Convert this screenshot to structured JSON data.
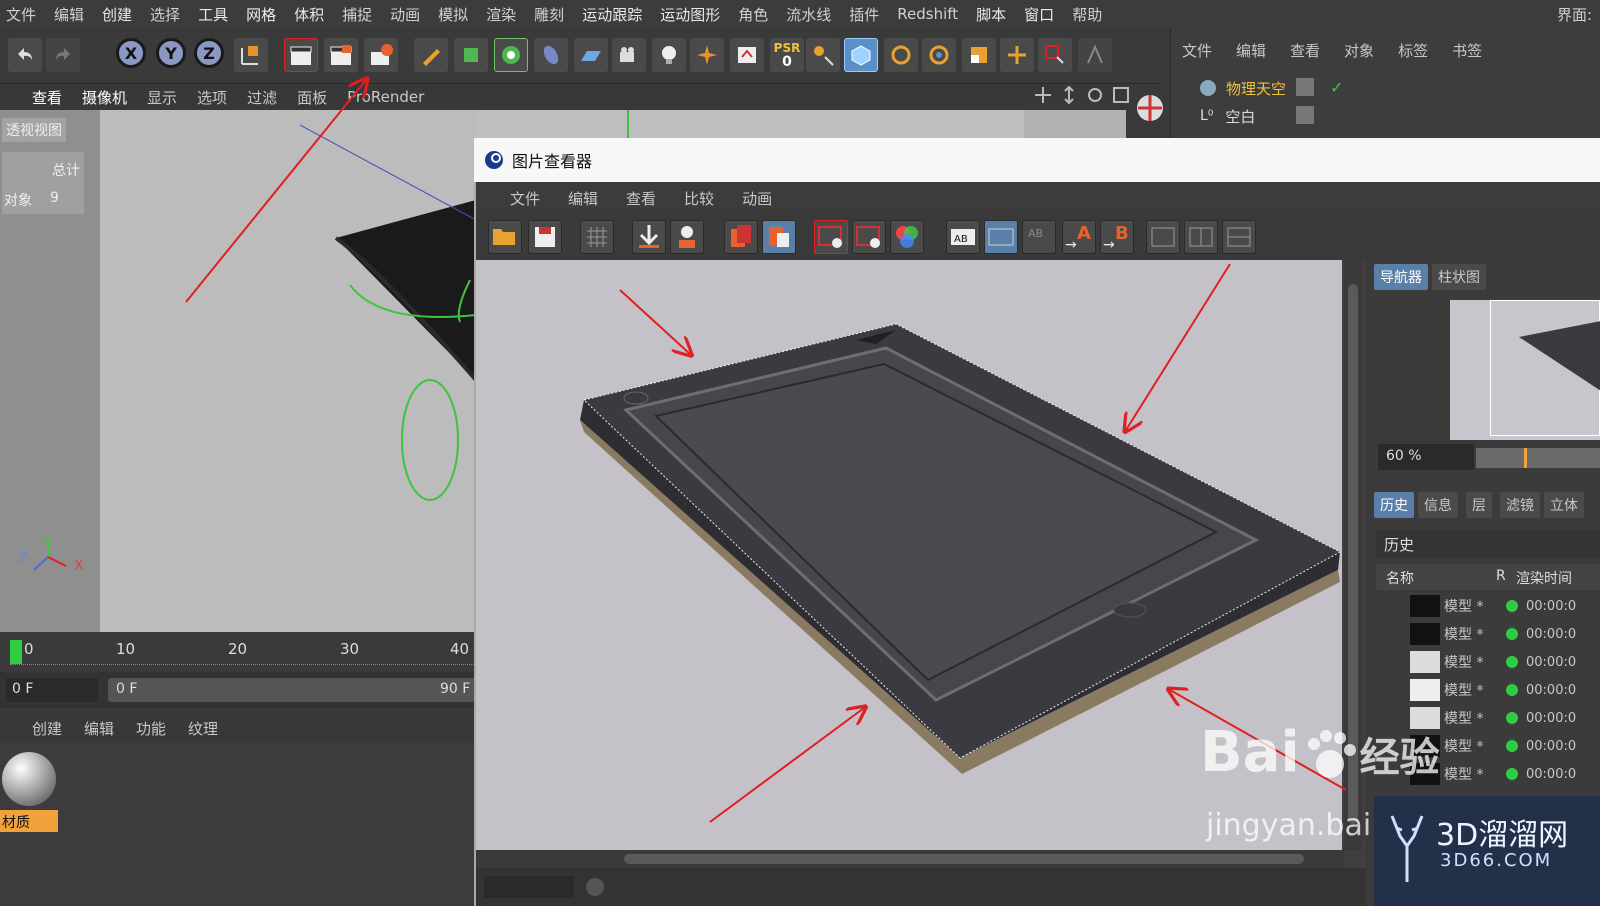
{
  "menubar": {
    "items": [
      {
        "label": "文件",
        "hl": false
      },
      {
        "label": "编辑",
        "hl": false
      },
      {
        "label": "创建",
        "hl": false
      },
      {
        "label": "选择",
        "hl": false
      },
      {
        "label": "工具",
        "hl": false
      },
      {
        "label": "网格",
        "hl": false
      },
      {
        "label": "体积",
        "hl": false
      },
      {
        "label": "捕捉",
        "hl": false
      },
      {
        "label": "动画",
        "hl": false
      },
      {
        "label": "模拟",
        "hl": false
      },
      {
        "label": "渲染",
        "hl": false
      },
      {
        "label": "雕刻",
        "hl": false
      },
      {
        "label": "运动跟踪",
        "hl": false
      },
      {
        "label": "运动图形",
        "hl": false
      },
      {
        "label": "角色",
        "hl": false
      },
      {
        "label": "流水线",
        "hl": false
      },
      {
        "label": "插件",
        "hl": false
      },
      {
        "label": "Redshift",
        "hl": false
      },
      {
        "label": "脚本",
        "hl": false
      },
      {
        "label": "窗口",
        "hl": false
      },
      {
        "label": "帮助",
        "hl": false
      }
    ],
    "layout_label": "界面:"
  },
  "toolbar": {
    "axis_x": "X",
    "axis_y": "Y",
    "axis_z": "Z",
    "psr_label": "PSR",
    "psr_value": "0"
  },
  "viewport": {
    "menu": [
      "查看",
      "摄像机",
      "显示",
      "选项",
      "过滤",
      "面板",
      "ProRender"
    ],
    "view_name": "透视视图",
    "stats_total": "总计",
    "stats_objects_label": "对象",
    "stats_objects_value": "9",
    "axis_labels": {
      "z": "Z",
      "y": "Y",
      "x": "X"
    }
  },
  "object_manager": {
    "tabs": [
      "文件",
      "编辑",
      "查看",
      "对象",
      "标签",
      "书签"
    ],
    "objects": [
      {
        "name": "物理天空"
      },
      {
        "name": "空白"
      }
    ]
  },
  "timeline": {
    "ticks": [
      "0",
      "10",
      "20",
      "30",
      "40"
    ],
    "current_frame": "0 F",
    "range_start": "0 F",
    "range_end": "90 F"
  },
  "material_manager": {
    "menu": [
      "创建",
      "编辑",
      "功能",
      "纹理"
    ],
    "material_name": "材质"
  },
  "picture_viewer": {
    "title": "图片查看器",
    "menu": [
      "文件",
      "编辑",
      "查看",
      "比较",
      "动画"
    ],
    "compare_a": "A",
    "compare_b": "B",
    "side_tabs": [
      "导航器",
      "柱状图"
    ],
    "zoom": "60 %",
    "lower_tabs": [
      "历史",
      "信息",
      "层",
      "滤镜",
      "立体"
    ],
    "history_title": "历史",
    "col_name": "名称",
    "col_r": "R",
    "col_time": "渲染时间",
    "history": [
      {
        "name": "模型 *",
        "time": "00:00:0"
      },
      {
        "name": "模型 *",
        "time": "00:00:0"
      },
      {
        "name": "模型 *",
        "time": "00:00:0"
      },
      {
        "name": "模型 *",
        "time": "00:00:0"
      },
      {
        "name": "模型 *",
        "time": "00:00:0"
      },
      {
        "name": "模型 *",
        "time": "00:00:0"
      },
      {
        "name": "模型 *",
        "time": "00:00:0"
      }
    ]
  },
  "watermarks": {
    "baidu": "Bai",
    "baidu2": "经验",
    "jingyan": "jingyan.bai",
    "logo_cn": "3D溜溜网",
    "logo_en": "3D66.COM"
  },
  "colors": {
    "accent_yellow": "#f2c23a",
    "arrow_red": "#e02020",
    "history_dot": "#2ecc40",
    "active_tab": "#5a7fa8",
    "canvas_bg": "#c4c1c8"
  }
}
